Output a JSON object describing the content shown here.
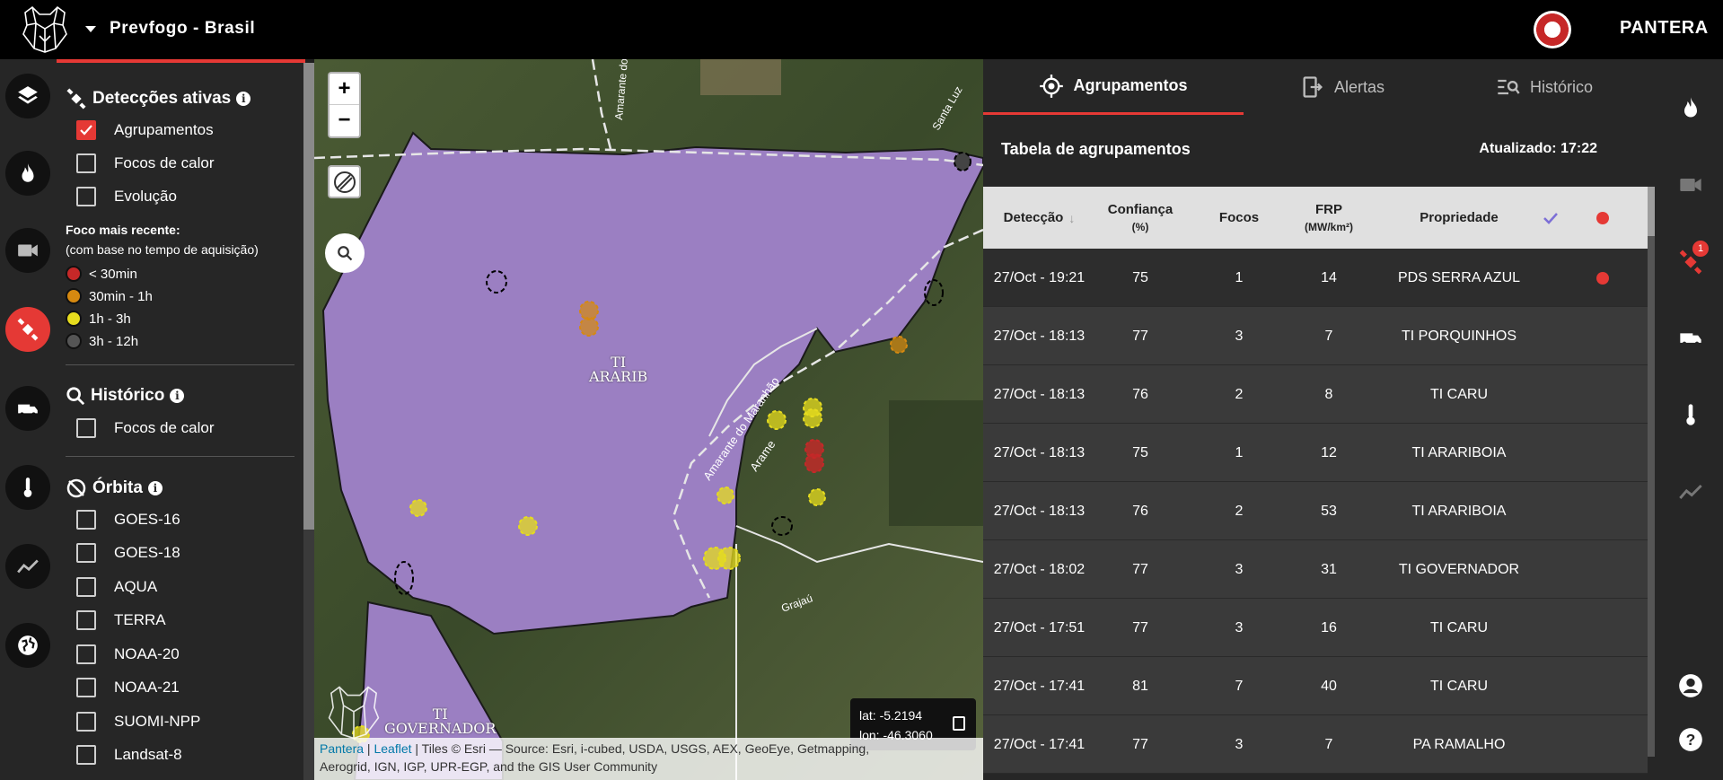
{
  "header": {
    "title": "Prevfogo - Brasil",
    "brand": "PANTERA"
  },
  "left_panel": {
    "active_detections": {
      "title": "Detecções ativas",
      "options": [
        {
          "label": "Agrupamentos",
          "checked": true
        },
        {
          "label": "Focos de calor",
          "checked": false
        },
        {
          "label": "Evolução",
          "checked": false
        }
      ],
      "legend_title": "Foco mais recente:",
      "legend_subtitle": "(com base no tempo de aquisição)",
      "legend": [
        {
          "label": "< 30min",
          "color": "#c62828"
        },
        {
          "label": "30min - 1h",
          "color": "#d68910"
        },
        {
          "label": "1h - 3h",
          "color": "#e6dc1e"
        },
        {
          "label": "3h - 12h",
          "color": "#555555"
        }
      ]
    },
    "history": {
      "title": "Histórico",
      "options": [
        {
          "label": "Focos de calor",
          "checked": false
        }
      ]
    },
    "orbit": {
      "title": "Órbita",
      "options": [
        {
          "label": "GOES-16",
          "checked": false
        },
        {
          "label": "GOES-18",
          "checked": false
        },
        {
          "label": "AQUA",
          "checked": false
        },
        {
          "label": "TERRA",
          "checked": false
        },
        {
          "label": "NOAA-20",
          "checked": false
        },
        {
          "label": "NOAA-21",
          "checked": false
        },
        {
          "label": "SUOMI-NPP",
          "checked": false
        },
        {
          "label": "Landsat-8",
          "checked": false
        }
      ]
    }
  },
  "map": {
    "zoom_in": "+",
    "zoom_out": "−",
    "labels": [
      {
        "line1": "TI",
        "line2": "ARARIB"
      },
      {
        "line1": "TI",
        "line2": "GOVERNADOR"
      }
    ],
    "road_labels": [
      "Amarante do Maranhão",
      "Arame",
      "Grajaú",
      "Santa Luz"
    ],
    "coords": {
      "lat": "lat: -5.2194",
      "lon": "lon: -46.3060"
    },
    "attribution": {
      "link1": "Pantera",
      "sep": " | ",
      "link2": "Leaflet",
      "text1": " | Tiles © Esri — Source: Esri, i-cubed, USDA, USGS, AEX, GeoEye, Getmapping,",
      "text2": "Aerogrid, IGN, IGP, UPR-EGP, and the GIS User Community"
    },
    "polygon_color": "#9b7fc2"
  },
  "right_panel": {
    "tabs": [
      {
        "label": "Agrupamentos",
        "active": true
      },
      {
        "label": "Alertas",
        "active": false
      },
      {
        "label": "Histórico",
        "active": false
      }
    ],
    "table_title": "Tabela de agrupamentos",
    "updated": "Atualizado: 17:22",
    "columns": {
      "detection": "Detecção",
      "confidence": "Confiança",
      "confidence_unit": "(%)",
      "foci": "Focos",
      "frp": "FRP",
      "frp_unit": "(MW/km²)",
      "property": "Propriedade"
    },
    "rows": [
      {
        "detection": "27/Oct - 19:21",
        "confidence": "75",
        "foci": "1",
        "frp": "14",
        "property": "PDS SERRA AZUL",
        "alert": true
      },
      {
        "detection": "27/Oct - 18:13",
        "confidence": "77",
        "foci": "3",
        "frp": "7",
        "property": "TI PORQUINHOS",
        "alert": false
      },
      {
        "detection": "27/Oct - 18:13",
        "confidence": "76",
        "foci": "2",
        "frp": "8",
        "property": "TI CARU",
        "alert": false
      },
      {
        "detection": "27/Oct - 18:13",
        "confidence": "75",
        "foci": "1",
        "frp": "12",
        "property": "TI ARARIBOIA",
        "alert": false
      },
      {
        "detection": "27/Oct - 18:13",
        "confidence": "76",
        "foci": "2",
        "frp": "53",
        "property": "TI ARARIBOIA",
        "alert": false
      },
      {
        "detection": "27/Oct - 18:02",
        "confidence": "77",
        "foci": "3",
        "frp": "31",
        "property": "TI GOVERNADOR",
        "alert": false
      },
      {
        "detection": "27/Oct - 17:51",
        "confidence": "77",
        "foci": "3",
        "frp": "16",
        "property": "TI CARU",
        "alert": false
      },
      {
        "detection": "27/Oct - 17:41",
        "confidence": "81",
        "foci": "7",
        "frp": "40",
        "property": "TI CARU",
        "alert": false
      },
      {
        "detection": "27/Oct - 17:41",
        "confidence": "77",
        "foci": "3",
        "frp": "7",
        "property": "PA RAMALHO",
        "alert": false
      }
    ]
  },
  "right_rail": {
    "alerts_badge": "1"
  },
  "colors": {
    "accent": "#e53935",
    "check_color": "#7c6fd6"
  }
}
